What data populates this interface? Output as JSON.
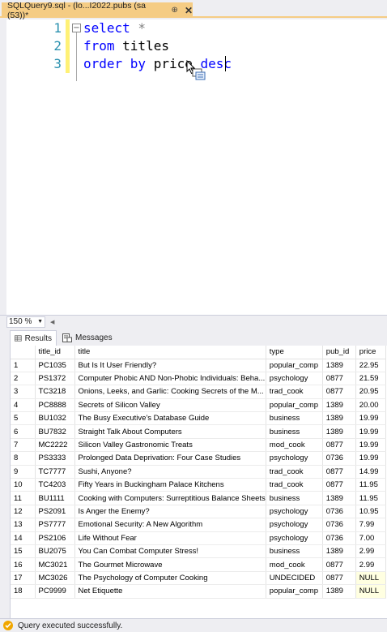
{
  "tab": {
    "title": "SQLQuery9.sql - (lo...I2022.pubs (sa (53))*",
    "pin": "⊕",
    "close": "✕"
  },
  "editor": {
    "lines": [
      {
        "num": "1",
        "kw": "select",
        "rest": " *",
        "rest_class": "gray"
      },
      {
        "num": "2",
        "kw": "from",
        "rest": " titles",
        "rest_class": "plain"
      },
      {
        "num": "3",
        "kw": "order by",
        "rest": " price ",
        "kw2": "desc"
      }
    ],
    "fold_symbol": "−"
  },
  "zoom": {
    "value": "150 %"
  },
  "results_tabs": {
    "results_label": "Results",
    "messages_label": "Messages"
  },
  "grid": {
    "columns": [
      "",
      "title_id",
      "title",
      "type",
      "pub_id",
      "price"
    ],
    "rows": [
      [
        "1",
        "PC1035",
        "But Is It User Friendly?",
        "popular_comp",
        "1389",
        "22.95"
      ],
      [
        "2",
        "PS1372",
        "Computer Phobic AND Non-Phobic Individuals: Beha...",
        "psychology",
        "0877",
        "21.59"
      ],
      [
        "3",
        "TC3218",
        "Onions, Leeks, and Garlic: Cooking Secrets of the M...",
        "trad_cook",
        "0877",
        "20.95"
      ],
      [
        "4",
        "PC8888",
        "Secrets of Silicon Valley",
        "popular_comp",
        "1389",
        "20.00"
      ],
      [
        "5",
        "BU1032",
        "The Busy Executive's Database Guide",
        "business",
        "1389",
        "19.99"
      ],
      [
        "6",
        "BU7832",
        "Straight Talk About Computers",
        "business",
        "1389",
        "19.99"
      ],
      [
        "7",
        "MC2222",
        "Silicon Valley Gastronomic Treats",
        "mod_cook",
        "0877",
        "19.99"
      ],
      [
        "8",
        "PS3333",
        "Prolonged Data Deprivation: Four Case Studies",
        "psychology",
        "0736",
        "19.99"
      ],
      [
        "9",
        "TC7777",
        "Sushi, Anyone?",
        "trad_cook",
        "0877",
        "14.99"
      ],
      [
        "10",
        "TC4203",
        "Fifty Years in Buckingham Palace Kitchens",
        "trad_cook",
        "0877",
        "11.95"
      ],
      [
        "11",
        "BU1111",
        "Cooking with Computers: Surreptitious Balance Sheets",
        "business",
        "1389",
        "11.95"
      ],
      [
        "12",
        "PS2091",
        "Is Anger the Enemy?",
        "psychology",
        "0736",
        "10.95"
      ],
      [
        "13",
        "PS7777",
        "Emotional Security: A New Algorithm",
        "psychology",
        "0736",
        "7.99"
      ],
      [
        "14",
        "PS2106",
        "Life Without Fear",
        "psychology",
        "0736",
        "7.00"
      ],
      [
        "15",
        "BU2075",
        "You Can Combat Computer Stress!",
        "business",
        "1389",
        "2.99"
      ],
      [
        "16",
        "MC3021",
        "The Gourmet Microwave",
        "mod_cook",
        "0877",
        "2.99"
      ],
      [
        "17",
        "MC3026",
        "The Psychology of Computer Cooking",
        "UNDECIDED",
        "0877",
        "NULL"
      ],
      [
        "18",
        "PC9999",
        "Net Etiquette",
        "popular_comp",
        "1389",
        "NULL"
      ]
    ]
  },
  "status": {
    "text": "Query executed successfully."
  },
  "colors": {
    "tab_active": "#f5cc84",
    "keyword": "#0000ff",
    "line_number": "#2b91af",
    "null_cell": "#ffffe1",
    "status_icon": "#f0a600"
  }
}
